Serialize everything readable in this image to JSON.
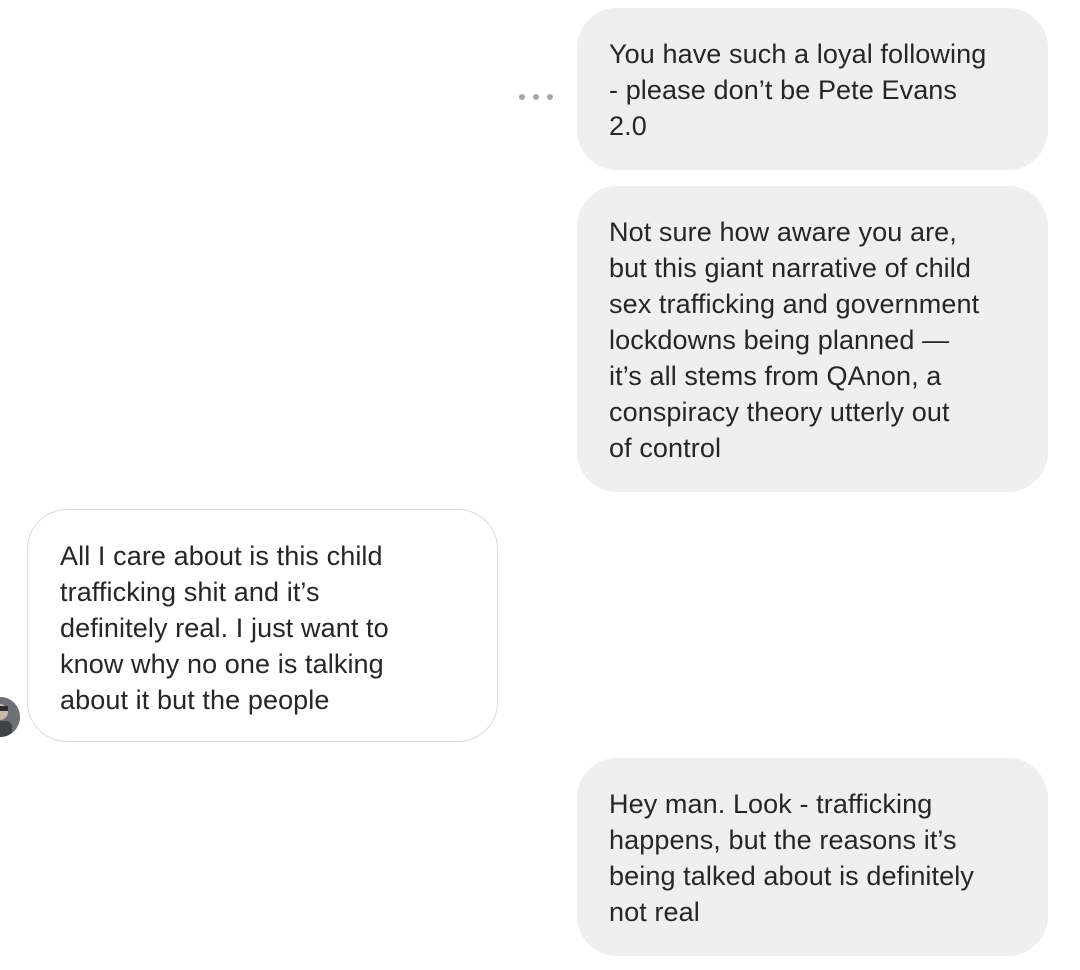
{
  "messages": [
    {
      "direction": "sent",
      "text": "You have such a loyal following\n- please don’t be Pete Evans\n2.0"
    },
    {
      "direction": "sent",
      "text": "Not sure how aware you are,\nbut this giant narrative of child\nsex trafficking and government\nlockdowns being planned —\nit’s all stems from QAnon, a\nconspiracy theory utterly out\nof control"
    },
    {
      "direction": "received",
      "text": "All I care about is this child\ntrafficking shit and it’s\ndefinitely real. I just want to\nknow why no one is talking\nabout it but the people"
    },
    {
      "direction": "sent",
      "text": "Hey man. Look - trafficking\nhappens, but the reasons it’s\nbeing talked about is definitely\nnot real"
    }
  ],
  "icons": {
    "more_options": "more-horizontal-icon",
    "sender_avatar": "avatar"
  },
  "colors": {
    "sent_bubble": "#efefef",
    "received_bubble": "#ffffff",
    "received_border": "#dbdbdb",
    "text": "#262626",
    "icon": "#a8a8a8"
  }
}
